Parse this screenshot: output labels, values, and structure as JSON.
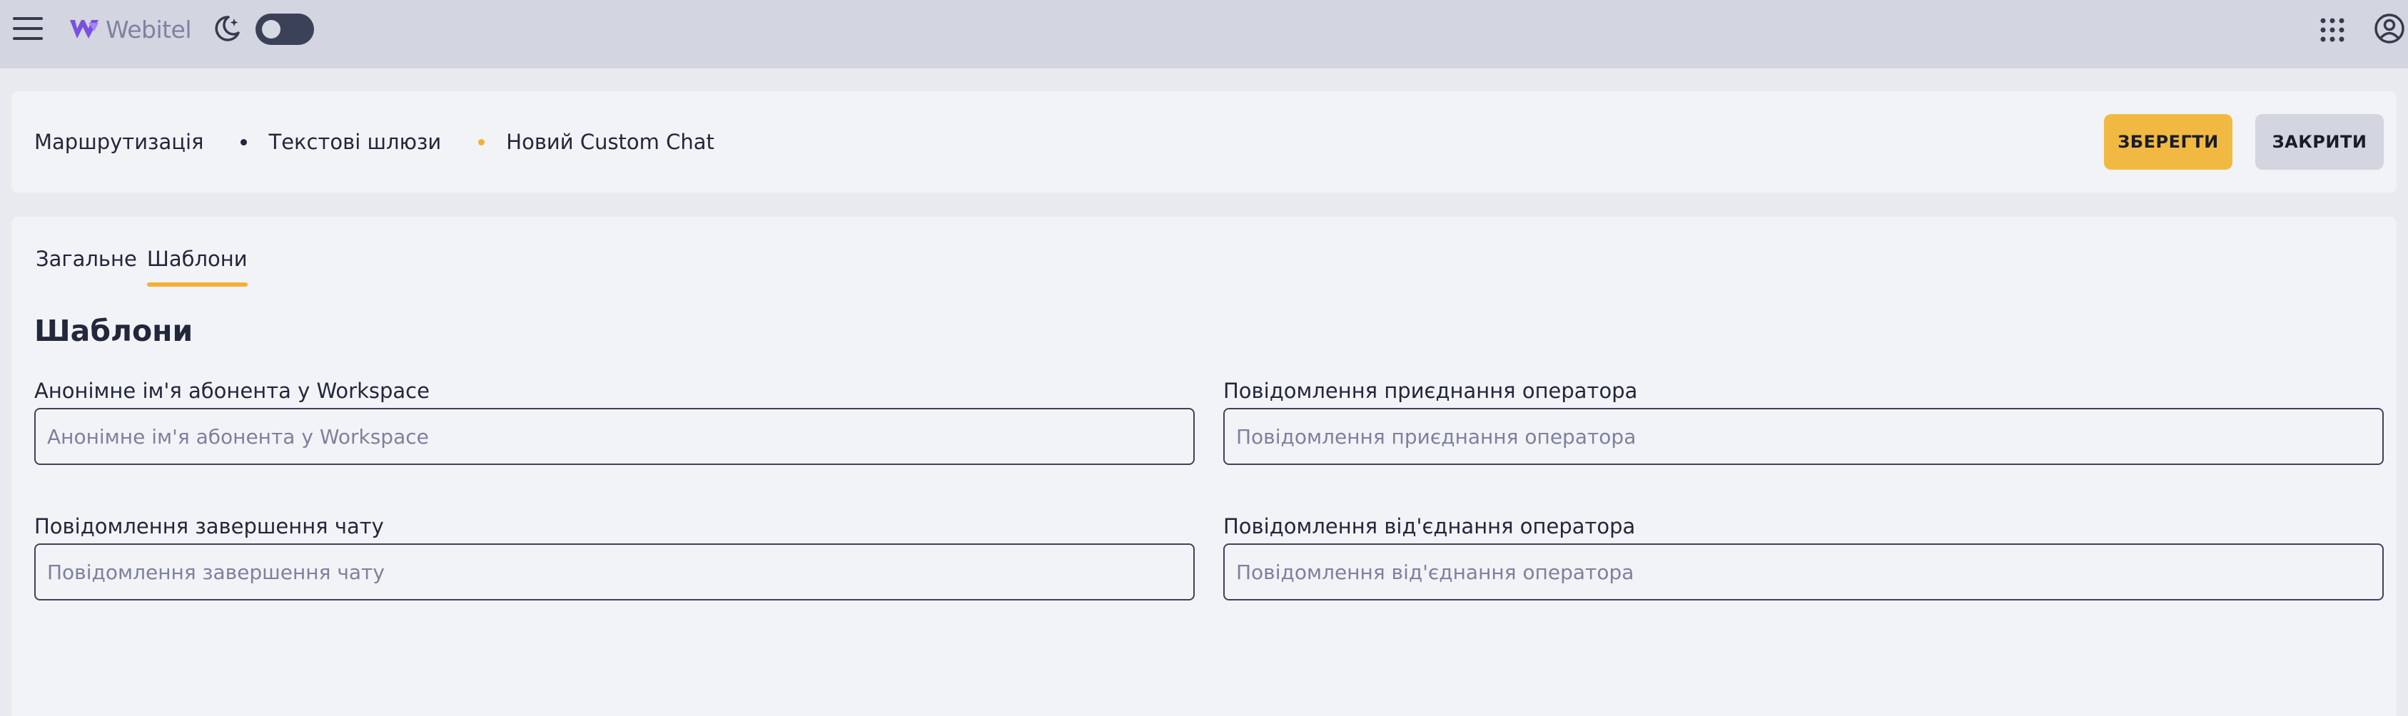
{
  "topbar": {
    "logo_text": "Webitel",
    "icons": {
      "menu": "hamburger-menu-icon",
      "logo": "webitel-logo-icon",
      "theme": "moon-icon",
      "apps": "apps-grid-icon",
      "account": "account-icon"
    },
    "theme_toggle": {
      "state": "off"
    }
  },
  "breadcrumb": [
    {
      "label": "Маршрутизація"
    },
    {
      "label": "Текстові шлюзи"
    },
    {
      "label": "Новий Custom Chat"
    }
  ],
  "actions": {
    "save_label": "ЗБЕРЕГТИ",
    "close_label": "ЗАКРИТИ"
  },
  "tabs": [
    {
      "label": "Загальне",
      "active": false
    },
    {
      "label": "Шаблони",
      "active": true
    }
  ],
  "section": {
    "title": "Шаблони",
    "fields": [
      {
        "label": "Анонімне ім'я абонента у Workspace",
        "value": "",
        "placeholder": "Анонімне ім'я абонента у Workspace"
      },
      {
        "label": "Повідомлення приєднання оператора",
        "value": "",
        "placeholder": "Повідомлення приєднання оператора"
      },
      {
        "label": "Повідомлення завершення чату",
        "value": "",
        "placeholder": "Повідомлення завершення чату"
      },
      {
        "label": "Повідомлення від'єднання оператора",
        "value": "",
        "placeholder": "Повідомлення від'єднання оператора"
      }
    ]
  },
  "colors": {
    "accent": "#f2b134",
    "topbar_bg": "#d3d5e0",
    "card_bg": "#f2f3f7",
    "text": "#23273a",
    "placeholder": "#7d819c"
  }
}
